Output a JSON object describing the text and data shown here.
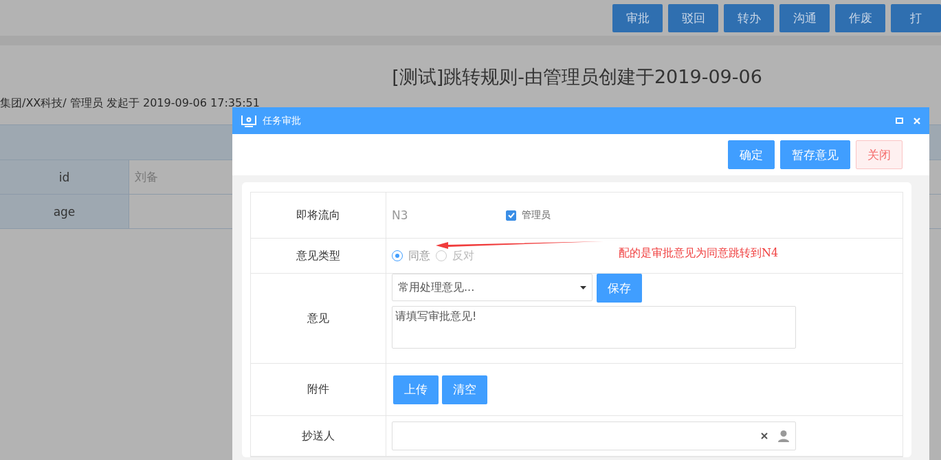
{
  "toolbar": {
    "buttons": [
      "审批",
      "驳回",
      "转办",
      "沟通",
      "作废",
      "打"
    ]
  },
  "page": {
    "title": "[测试]跳转规则-由管理员创建于2019-09-06",
    "meta": "集团/XX科技/  管理员 发起于 2019-09-06 17:35:51"
  },
  "form_table": {
    "rows": [
      {
        "label": "id",
        "value": "刘备"
      },
      {
        "label": "age",
        "value": ""
      }
    ]
  },
  "dialog": {
    "title": "任务审批",
    "actions": [
      {
        "label": "确定",
        "kind": "primary"
      },
      {
        "label": "暂存意见",
        "kind": "primary"
      },
      {
        "label": "关闭",
        "kind": "danger"
      }
    ],
    "next_node": {
      "label": "即将流向",
      "value": "N3",
      "assignee": {
        "label": "管理员",
        "checked": true
      }
    },
    "opinion_type": {
      "label": "意见类型",
      "options": [
        {
          "label": "同意",
          "selected": true
        },
        {
          "label": "反对",
          "selected": false
        }
      ]
    },
    "opinion": {
      "label": "意见",
      "select": "常用处理意见...",
      "save_button": "保存",
      "placeholder": "请填写审批意见!"
    },
    "attachment": {
      "label": "附件",
      "buttons": [
        "上传",
        "清空"
      ]
    },
    "cc": {
      "label": "抄送人"
    }
  },
  "annotation": {
    "text": "配的是审批意见为同意跳转到N4"
  }
}
